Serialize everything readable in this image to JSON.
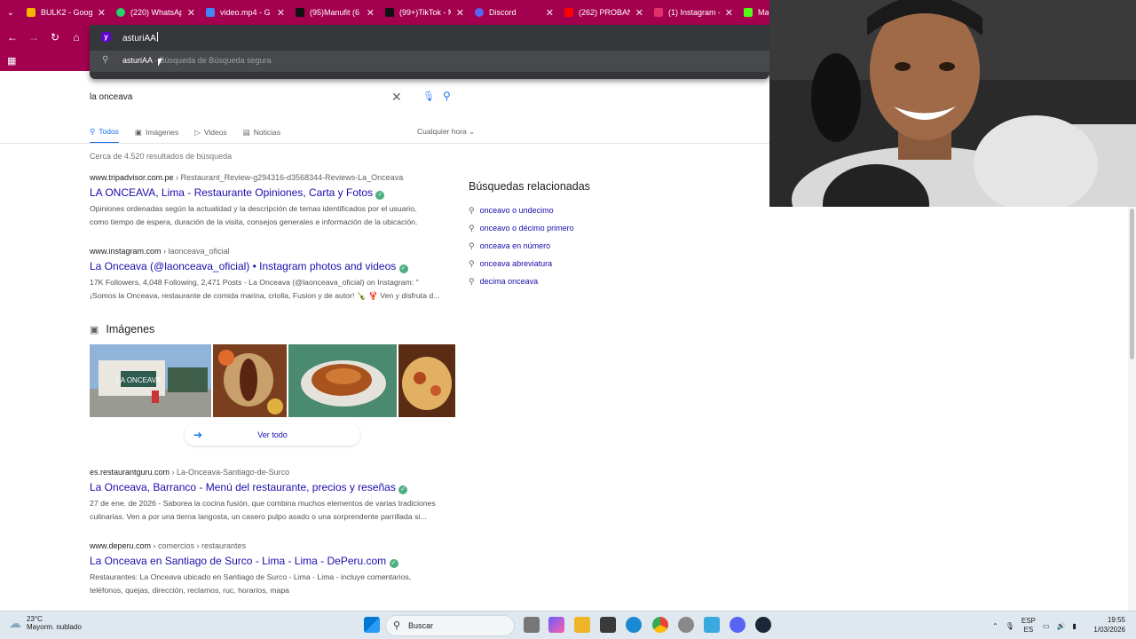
{
  "browser": {
    "tabs": [
      {
        "title": "BULK2 - Googl",
        "icon": "drive-icon",
        "color": "#f4b400"
      },
      {
        "title": "(220) WhatsAp",
        "icon": "whatsapp-icon",
        "color": "#25d366"
      },
      {
        "title": "video.mp4 - G",
        "icon": "drive-icon",
        "color": "#4285f4"
      },
      {
        "title": "(95)Manufit (6",
        "icon": "tiktok-icon",
        "color": "#111111"
      },
      {
        "title": "(99+)TikTok - M",
        "icon": "tiktok-icon",
        "color": "#111111"
      },
      {
        "title": "Discord",
        "icon": "discord-icon",
        "color": "#5865f2"
      },
      {
        "title": "(262) PROBAN",
        "icon": "youtube-icon",
        "color": "#ff0000"
      },
      {
        "title": "(1) Instagram -",
        "icon": "instagram-icon",
        "color": "#e1306c"
      },
      {
        "title": "Ma",
        "icon": "kick-icon",
        "color": "#53fc18"
      }
    ],
    "omnibox": {
      "typed": "asturiAA",
      "suggestion_query": "asturiAA",
      "suggestion_hint": "- Búsqueda de Búsqueda segura"
    }
  },
  "search": {
    "query": "la onceava",
    "tabs": [
      "Todos",
      "Imágenes",
      "Videos",
      "Noticias"
    ],
    "time_filter": "Cualquier hora",
    "result_count": "Cerca de 4.520 resultados de búsqueda",
    "results": [
      {
        "domain": "www.tripadvisor.com.pe",
        "path": " › Restaurant_Review-g294316-d3568344-Reviews-La_Onceava",
        "title": "LA ONCEAVA, Lima - Restaurante Opiniones, Carta y Fotos",
        "snippet1": "Opiniones ordenadas según la actualidad y la descripción de temas identificados por el usuario,",
        "snippet2": "como tiempo de espera, duración de la visita, consejos generales e información de la ubicación."
      },
      {
        "domain": "www.instagram.com",
        "path": " › laonceava_oficial",
        "title": "La Onceava (@laonceava_oficial) • Instagram photos and videos",
        "snippet1": "17K Followers, 4,048 Following, 2,471 Posts - La Onceava (@laonceava_oficial) on Instagram: \"",
        "snippet2": "¡Somos la Onceava, restaurante de comida marina, criolla, Fusion y de autor! 🍾 🦞 Ven y disfruta d..."
      },
      {
        "domain": "es.restaurantguru.com",
        "path": " › La-Onceava-Santiago-de-Surco",
        "title": "La Onceava, Barranco - Menú del restaurante, precios y reseñas",
        "snippet1": "27 de ene. de 2026 - Saborea la cocina fusión, que combina muchos elementos de varias tradiciones",
        "snippet2": "culinarias. Ven a por una tierna langosta, un casero pulpo asado o una sorprendente parrillada si..."
      },
      {
        "domain": "www.deperu.com",
        "path": " › comercios › restaurantes",
        "title": "La Onceava en Santiago de Surco - Lima - Lima - DePeru.com",
        "snippet1": "Restaurantes: La Onceava ubicado en Santiago de Surco - Lima - Lima - incluye comentarios,",
        "snippet2": "teléfonos, quejas, dirección, reclamos, ruc, horarios, mapa"
      }
    ],
    "images": {
      "heading": "Imágenes",
      "see_all": "Ver todo",
      "sign_text": "LA ONCEAVA"
    },
    "related": {
      "heading": "Búsquedas relacionadas",
      "items": [
        "onceavo o undecimo",
        "onceavo o décimo primero",
        "onceava en número",
        "onceava abreviatura",
        "decima onceava"
      ]
    }
  },
  "taskbar": {
    "weather_temp": "23°C",
    "weather_desc": "Mayorm. nublado",
    "search_label": "Buscar",
    "lang1": "ESP",
    "lang2": "ES",
    "time": "19:55",
    "date": "1/03/2026"
  },
  "colors": {
    "accent": "#a3004f",
    "link": "#1a0dab",
    "omnibox": "#35363a"
  }
}
